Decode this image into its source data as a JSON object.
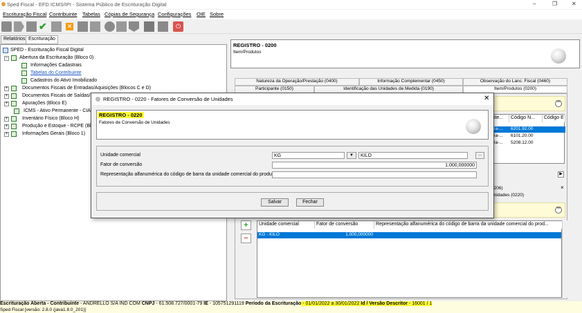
{
  "window": {
    "title": "Sped Fiscal - EFD ICMS/IPI - Sistema Público de Escrituração Digital",
    "controls": [
      "–",
      "❐",
      "✕"
    ]
  },
  "menu": [
    "Escrituração Fiscal",
    "Contribuinte",
    "Tabelas",
    "Cópias de Segurança",
    "Configurações",
    "OIE",
    "Sobre"
  ],
  "left_tabs": [
    "Relatórios",
    "Escrituração"
  ],
  "tree": {
    "root": "SPED - Escrituração Fiscal Digital",
    "items": [
      "Abertura da Escrituração (Bloco 0)",
      "Informações Cadastrais",
      "Tabelas do Contribuinte",
      "Cadastros do Ativo Imobilizado",
      "Documentos Fiscais de Entradas/Aquisições (Blocos C e D)",
      "Documentos Fiscais de Saídas/Pr",
      "Apurações (Bloco E)",
      "ICMS - Ativo Permanente - CIAP",
      "Inventário Físico (Bloco H)",
      "Produção e Estoque - RCPE (Bloc",
      "Informações Gerais (Bloco 1)"
    ]
  },
  "register_header": {
    "code": "REGISTRO - 0200",
    "desc": "Item/Produtos"
  },
  "tabs_row1": [
    "Natureza da Operação/Prestação (0400)",
    "Informação Complementar (0450)",
    "Observação do Lanc. Fiscal (0460)"
  ],
  "tabs_row2": [
    "Participante (0150)",
    "Identificação das Unidades de Medida (0190)",
    "Item/Produtos (0200)"
  ],
  "items_grid": {
    "headers": [
      "o ite...",
      "Código N...",
      "Código E"
    ],
    "rows": [
      [
        "ería-...",
        "6201.92.00",
        ""
      ],
      [
        "ería-...",
        "6101.20.00",
        ""
      ],
      [
        "ería-...",
        "5208.12.00",
        ""
      ]
    ]
  },
  "sub_section": {
    "line1": "0206)",
    "line2": "unidades (0220)",
    "close": "×"
  },
  "bottom_grid": {
    "headers": [
      "Unidade comercial",
      "Fator de conversão",
      "Representação alfanumérica do código de barra da unidade comercial do prod..."
    ],
    "rows": [
      [
        "KG - KILO",
        "1.000,000000",
        ""
      ]
    ],
    "add": "+",
    "remove": "−"
  },
  "modal": {
    "title": "REGISTRO - 0220 - Fatores de Conversão de Unidades",
    "code": "REGISTRO - 0220",
    "desc": "Fatores de Conversão de Unidades",
    "fields": {
      "unit_label": "Unidade comercial",
      "unit_code": "KG",
      "unit_name": "KILO",
      "factor_label": "Fator de conversão",
      "factor_value": "1.000,000000",
      "barcode_label": "Representação alfanumérica do código de barra da unidade comercial do produto",
      "barcode_value": ""
    },
    "ellipsis": "...",
    "save_label": "Salvar",
    "close_label": "Fechar"
  },
  "status": {
    "line1_prefix": "Escrituração Aberta - Contribuinte",
    "line1_company": " - ANDRELLO S/A IND COM ",
    "cnpj_label": "CNPJ",
    "cnpj": " - 61.508.727/0001-79 ",
    "ie_label": "IE",
    "ie": " - 105751291119 ",
    "period_label": "Período da Escrituração",
    "period": " - 01/01/2022 a 30/01/2022 ",
    "id_label": "Id / Versão Descritor",
    "id": " - 16001 / 1 ",
    "line2": "Sped Fiscal [versão: 2.8.0 (java1.8.0_201)]"
  },
  "colors": {
    "highlight": "#ffff33",
    "selection": "#0078d7",
    "yellow_panel": "#fffbd6"
  }
}
